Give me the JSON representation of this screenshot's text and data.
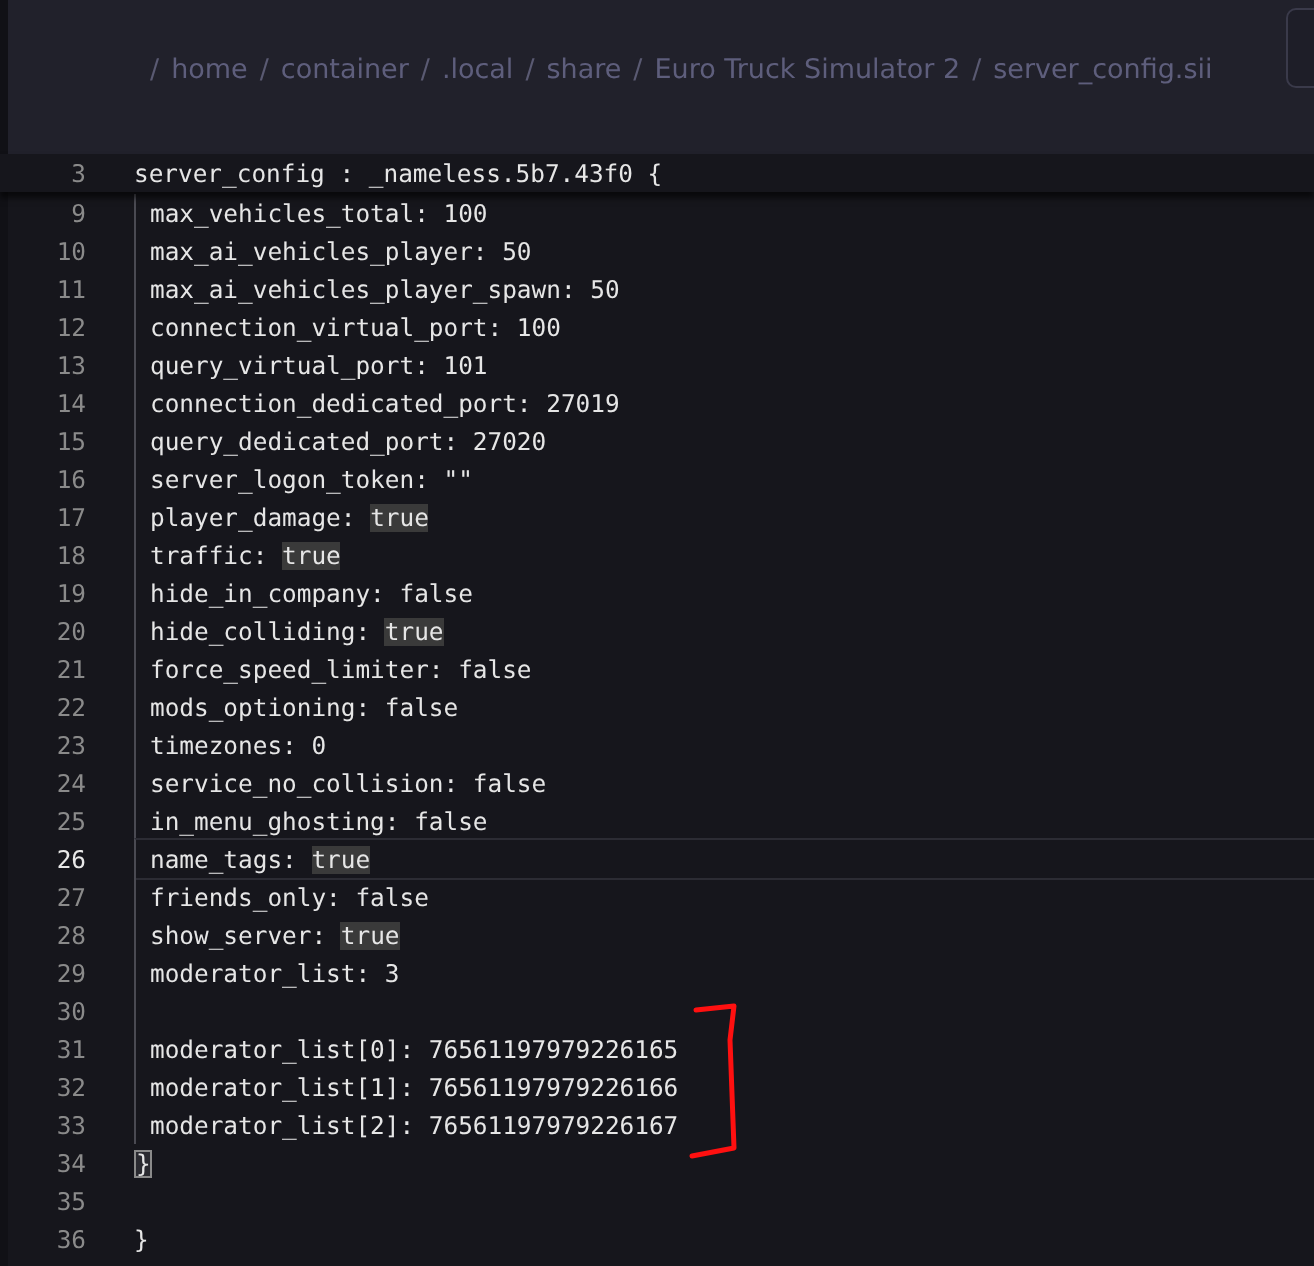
{
  "breadcrumb": [
    {
      "separator": "/",
      "label": "home"
    },
    {
      "separator": "/",
      "label": "container"
    },
    {
      "separator": "/",
      "label": ".local"
    },
    {
      "separator": "/",
      "label": "share"
    },
    {
      "separator": "/",
      "label": "Euro Truck Simulator 2"
    },
    {
      "separator": "/",
      "label": "server_config.sii"
    }
  ],
  "editor": {
    "sticky_line": {
      "number": "3",
      "text": "server_config : _nameless.5b7.43f0 {"
    },
    "block_lines": [
      {
        "number": "9",
        "text": "max_vehicles_total: 100",
        "current": false
      },
      {
        "number": "10",
        "text": "max_ai_vehicles_player: 50",
        "current": false
      },
      {
        "number": "11",
        "text": "max_ai_vehicles_player_spawn: 50",
        "current": false
      },
      {
        "number": "12",
        "text": "connection_virtual_port: 100",
        "current": false
      },
      {
        "number": "13",
        "text": "query_virtual_port: 101",
        "current": false
      },
      {
        "number": "14",
        "text": "connection_dedicated_port: 27019",
        "current": false
      },
      {
        "number": "15",
        "text": "query_dedicated_port: 27020",
        "current": false
      },
      {
        "number": "16",
        "text": "server_logon_token: \"\"",
        "current": false
      },
      {
        "number": "17",
        "text": "player_damage: ",
        "value": "true",
        "highlighted": true,
        "current": false
      },
      {
        "number": "18",
        "text": "traffic: ",
        "value": "true",
        "highlighted": true,
        "current": false
      },
      {
        "number": "19",
        "text": "hide_in_company: false",
        "current": false
      },
      {
        "number": "20",
        "text": "hide_colliding: ",
        "value": "true",
        "highlighted": true,
        "current": false
      },
      {
        "number": "21",
        "text": "force_speed_limiter: false",
        "current": false
      },
      {
        "number": "22",
        "text": "mods_optioning: false",
        "current": false
      },
      {
        "number": "23",
        "text": "timezones: 0",
        "current": false
      },
      {
        "number": "24",
        "text": "service_no_collision: false",
        "current": false
      },
      {
        "number": "25",
        "text": "in_menu_ghosting: false",
        "current": false
      },
      {
        "number": "26",
        "text": "name_tags: ",
        "value": "true",
        "highlighted": true,
        "current": true
      },
      {
        "number": "27",
        "text": "friends_only: false",
        "current": false
      },
      {
        "number": "28",
        "text": "show_server: ",
        "value": "true",
        "highlighted": true,
        "current": false
      },
      {
        "number": "29",
        "text": "moderator_list: 3",
        "current": false
      },
      {
        "number": "30",
        "current": false
      },
      {
        "number": "31",
        "text": "moderator_list[0]: 76561197979226165",
        "current": false
      },
      {
        "number": "32",
        "text": "moderator_list[1]: 76561197979226166",
        "current": false
      },
      {
        "number": "33",
        "text": "moderator_list[2]: 76561197979226167",
        "current": false
      }
    ],
    "after_lines": [
      {
        "number": "34",
        "text": "}",
        "matched_bracket": true
      },
      {
        "number": "35"
      },
      {
        "number": "36",
        "text": "}",
        "matched_bracket": false
      }
    ]
  }
}
